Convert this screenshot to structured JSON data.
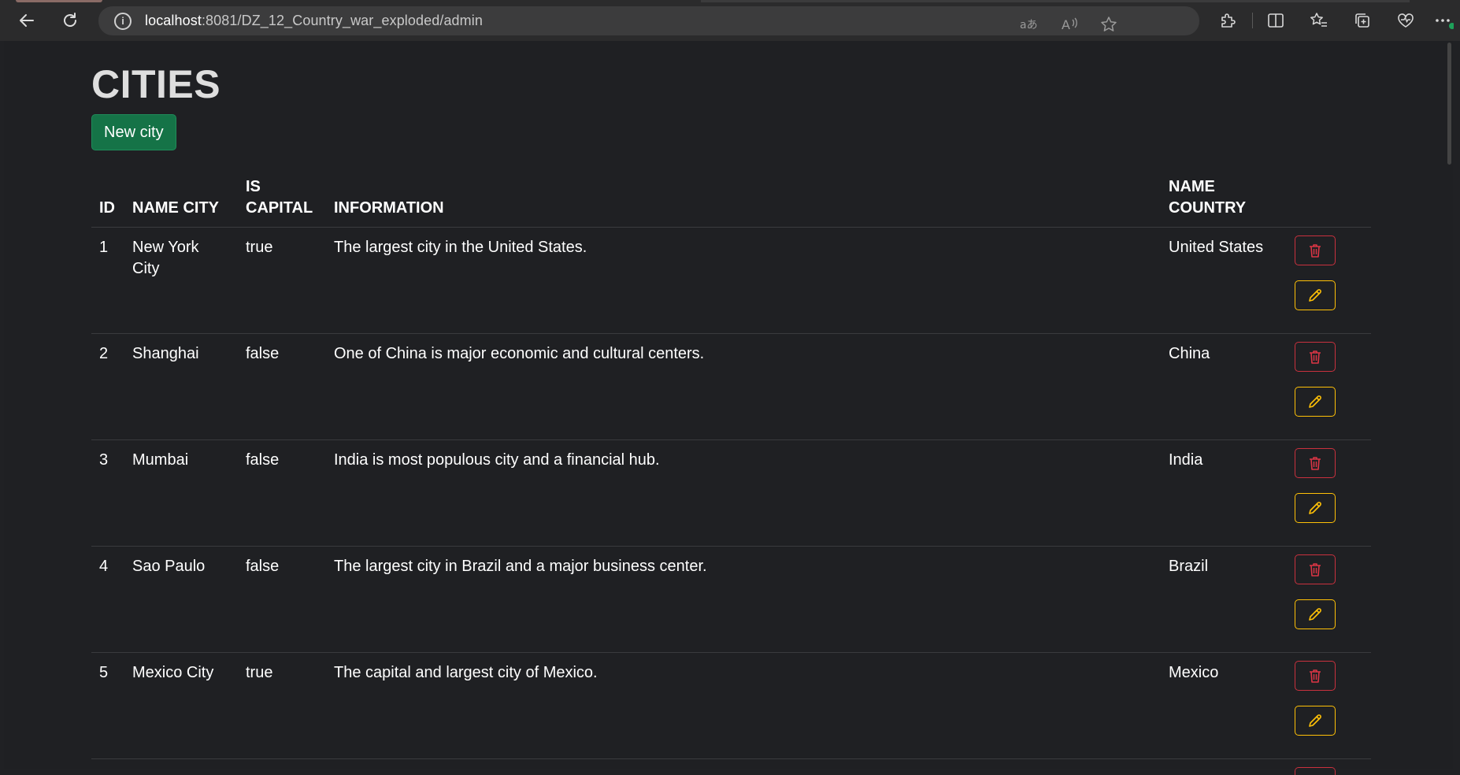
{
  "browser": {
    "url_host": "localhost",
    "url_path": ":8081/DZ_12_Country_war_exploded/admin"
  },
  "page": {
    "title": "CITIES",
    "new_button": "New city"
  },
  "table": {
    "headers": {
      "id": "ID",
      "name_city": "NAME CITY",
      "is_capital_1": "IS",
      "is_capital_2": "CAPITAL",
      "information": "INFORMATION",
      "name_country_1": "NAME",
      "name_country_2": "COUNTRY"
    },
    "rows": [
      {
        "id": "1",
        "name": "New York City",
        "capital": "true",
        "info": "The largest city in the United States.",
        "country": "United States"
      },
      {
        "id": "2",
        "name": "Shanghai",
        "capital": "false",
        "info": "One of China is major economic and cultural centers.",
        "country": "China"
      },
      {
        "id": "3",
        "name": "Mumbai",
        "capital": "false",
        "info": "India is most populous city and a financial hub.",
        "country": "India"
      },
      {
        "id": "4",
        "name": "Sao Paulo",
        "capital": "false",
        "info": "The largest city in Brazil and a major business center.",
        "country": "Brazil"
      },
      {
        "id": "5",
        "name": "Mexico City",
        "capital": "true",
        "info": "The capital and largest city of Mexico.",
        "country": "Mexico"
      }
    ]
  },
  "colors": {
    "page_bg": "#1f2023",
    "success": "#157347",
    "danger": "#dc3545",
    "warning": "#ffc107"
  },
  "icons": {
    "delete": "trash-icon",
    "edit": "pencil-icon"
  }
}
